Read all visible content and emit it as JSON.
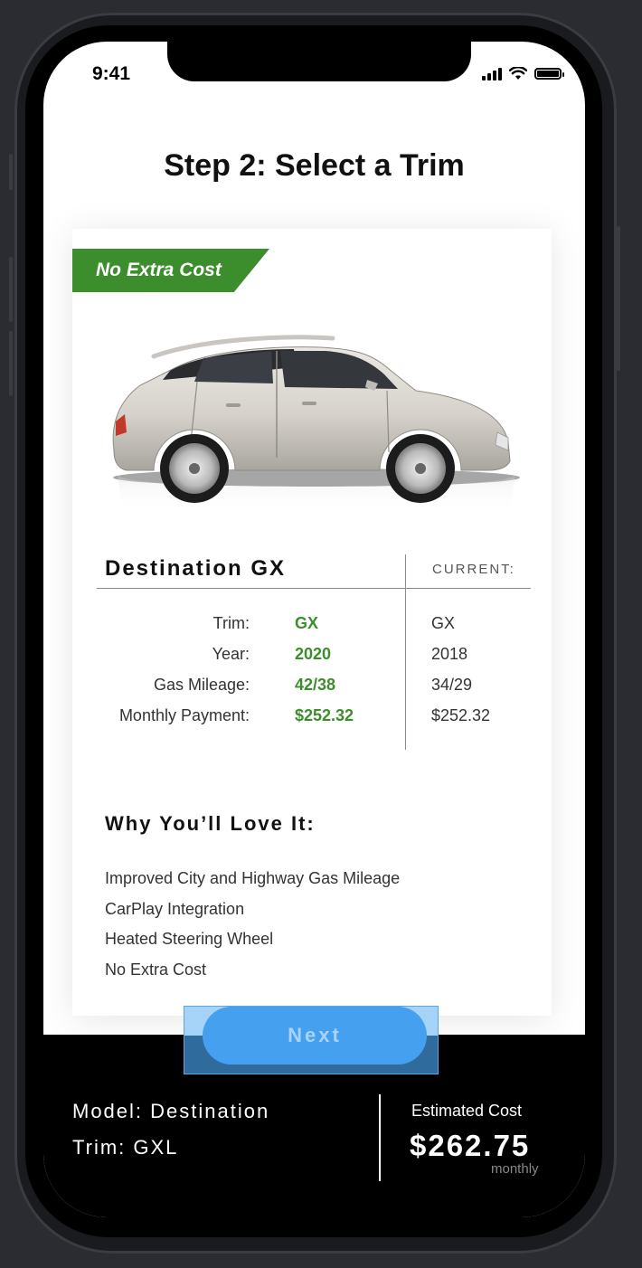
{
  "status": {
    "time": "9:41"
  },
  "title": "Step 2: Select a Trim",
  "badge": "No Extra Cost",
  "vehicle": {
    "name": "Destination GX",
    "current_header": "CURRENT:",
    "specs": [
      {
        "label": "Trim:",
        "value": "GX",
        "current": "GX"
      },
      {
        "label": "Year:",
        "value": "2020",
        "current": "2018"
      },
      {
        "label": "Gas Mileage:",
        "value": "42/38",
        "current": "34/29"
      },
      {
        "label": "Monthly Payment:",
        "value": "$252.32",
        "current": "$252.32"
      }
    ]
  },
  "love": {
    "title": "Why You’ll Love It:",
    "items": [
      "Improved City and Highway Gas Mileage",
      "CarPlay Integration",
      "Heated Steering Wheel",
      "No Extra Cost"
    ]
  },
  "next_label": "Next",
  "summary": {
    "model": "Model: Destination",
    "trim": "Trim: GXL",
    "estimated_label": "Estimated Cost",
    "estimated_amount": "$262.75",
    "estimated_period": "monthly"
  },
  "colors": {
    "accent_green": "#3c8e2c",
    "button_blue": "#46a0f0"
  }
}
